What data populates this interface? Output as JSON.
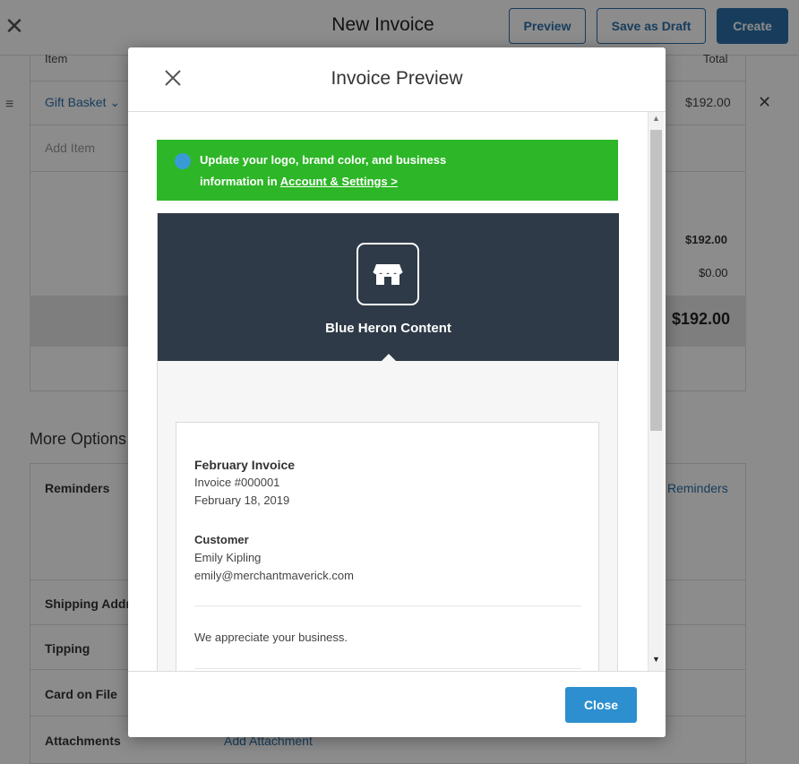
{
  "page": {
    "title": "New Invoice",
    "buttons": {
      "preview": "Preview",
      "save_draft": "Save as Draft",
      "create": "Create"
    },
    "items_table": {
      "columns": {
        "item": "Item",
        "total": "Total"
      },
      "rows": [
        {
          "item": "Gift Basket",
          "total": "$192.00"
        }
      ],
      "add_item_placeholder": "Add Item"
    },
    "summary": {
      "subtotal": "$192.00",
      "tax": "$0.00",
      "total": "$192.00"
    },
    "more_options": {
      "title": "More Options",
      "rows": [
        {
          "label": "Reminders",
          "link": "Reminders"
        },
        {
          "label": "Shipping Addr"
        },
        {
          "label": "Tipping"
        },
        {
          "label": "Card on File"
        },
        {
          "label": "Attachments",
          "link": "Add Attachment"
        }
      ]
    }
  },
  "modal": {
    "title": "Invoice Preview",
    "banner": {
      "line1": "Update your logo, brand color, and business",
      "line2_prefix": "information in ",
      "link": "Account & Settings >"
    },
    "business_name": "Blue Heron Content",
    "invoice": {
      "title": "February Invoice",
      "number": "Invoice #000001",
      "date": "February 18, 2019",
      "customer_label": "Customer",
      "customer_name": "Emily Kipling",
      "customer_email": "emily@merchantmaverick.com",
      "message": "We appreciate your business."
    },
    "close_label": "Close"
  },
  "colors": {
    "accent_blue": "#2c6fa8",
    "banner_green": "#2db627",
    "hero_dark": "#2f3a48",
    "close_button": "#2d8fcf"
  }
}
